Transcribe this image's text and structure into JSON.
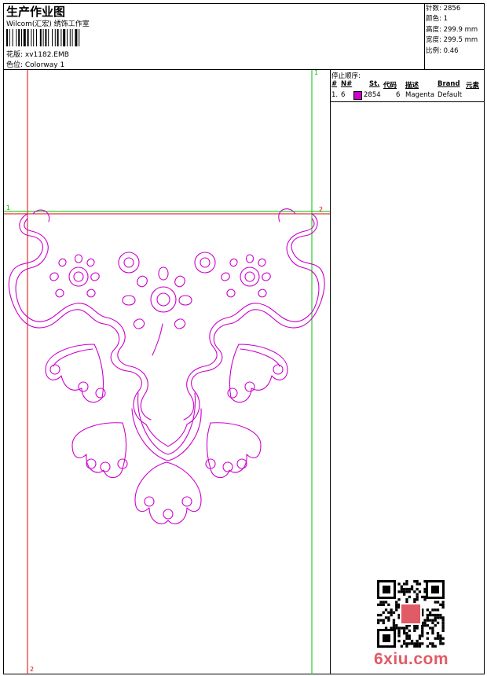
{
  "header": {
    "title": "生产作业图",
    "company": "Wilcom(汇宏) 绣饰工作室",
    "design": "花版: xv1182.EMB",
    "colorway": "色位: Colorway 1"
  },
  "stats": [
    {
      "label": "针数",
      "value": "2856"
    },
    {
      "label": "颜色",
      "value": "1"
    },
    {
      "label": "高度",
      "value": "299.9 mm"
    },
    {
      "label": "宽度",
      "value": "299.5 mm"
    },
    {
      "label": "比例",
      "value": "0.46"
    }
  ],
  "stop_sequence": {
    "title": "停止顺序:",
    "headers": [
      "#",
      "N#",
      "St.",
      "代码",
      "描述",
      "Brand",
      "元素"
    ],
    "rows": [
      {
        "index": "1.",
        "needle": "6",
        "color_hex": "#cc00cc",
        "stitches": "2854",
        "code": "6",
        "description": "Magenta",
        "brand": "Default",
        "elements": ""
      }
    ]
  },
  "guides": {
    "top_left": "1",
    "top_right": "1",
    "mid_left": "1",
    "mid_right": "2",
    "bottom_left": "2"
  },
  "colors": {
    "stitch": "#cc00cc",
    "guide_red": "#e00000",
    "guide_green": "#00c000",
    "watermark": "#e05b66"
  },
  "watermark": "6xiu.com"
}
